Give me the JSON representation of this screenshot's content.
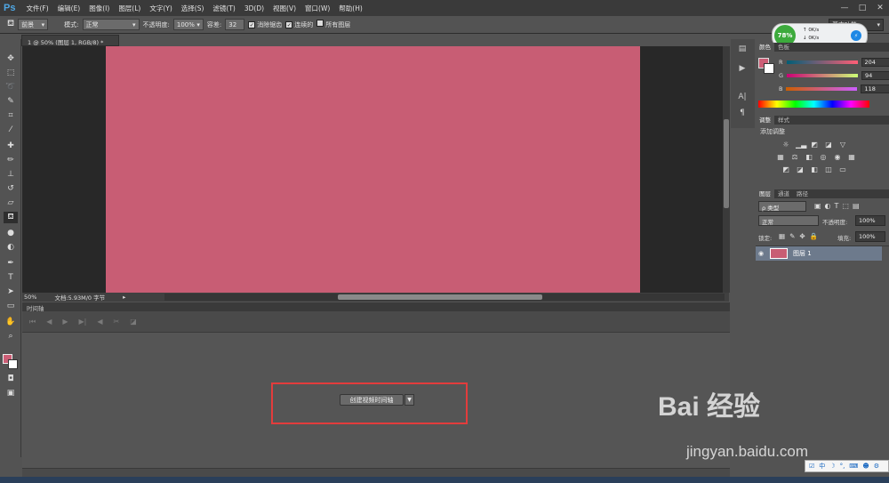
{
  "app": {
    "logo": "Ps",
    "menus": [
      "文件(F)",
      "编辑(E)",
      "图像(I)",
      "图层(L)",
      "文字(Y)",
      "选择(S)",
      "滤镜(T)",
      "3D(D)",
      "视图(V)",
      "窗口(W)",
      "帮助(H)"
    ],
    "win_controls": [
      "—",
      "□",
      "✕"
    ]
  },
  "options": {
    "fill_source": "前景",
    "mode_label": "模式:",
    "mode_value": "正常",
    "opacity_label": "不透明度:",
    "opacity_value": "100%",
    "tolerance_label": "容差:",
    "tolerance_value": "32",
    "anti_alias": "消除锯齿",
    "contiguous": "连续的",
    "all_layers": "所有图层",
    "workspace": "基本功能"
  },
  "perf": {
    "percent": "78%",
    "up": "0K/s",
    "down": "0K/s"
  },
  "document": {
    "tab": "1 @ 50% (图层 1, RGB/8) *",
    "zoom": "50%",
    "doc_size": "文档:5.93M/0 字节"
  },
  "timeline": {
    "title": "时间轴",
    "create_button": "创建视频时间轴"
  },
  "color_panel": {
    "tabs": [
      "颜色",
      "色板"
    ],
    "r_label": "R",
    "r": "204",
    "g_label": "G",
    "g": "94",
    "b_label": "B",
    "b": "118",
    "fg": "#cc5e76"
  },
  "adjust_panel": {
    "tabs": [
      "调整",
      "样式"
    ],
    "heading": "添加调整"
  },
  "layers_panel": {
    "tabs": [
      "图层",
      "通道",
      "路径"
    ],
    "kind": "ρ 类型",
    "blend": "正常",
    "opacity_label": "不透明度:",
    "opacity": "100%",
    "lock_label": "锁定:",
    "fill_label": "填充:",
    "fill": "100%",
    "layer_name": "图层 1"
  },
  "watermark": {
    "brand": "Bai 经验",
    "url": "jingyan.baidu.com"
  },
  "ime": {
    "label": "中"
  }
}
